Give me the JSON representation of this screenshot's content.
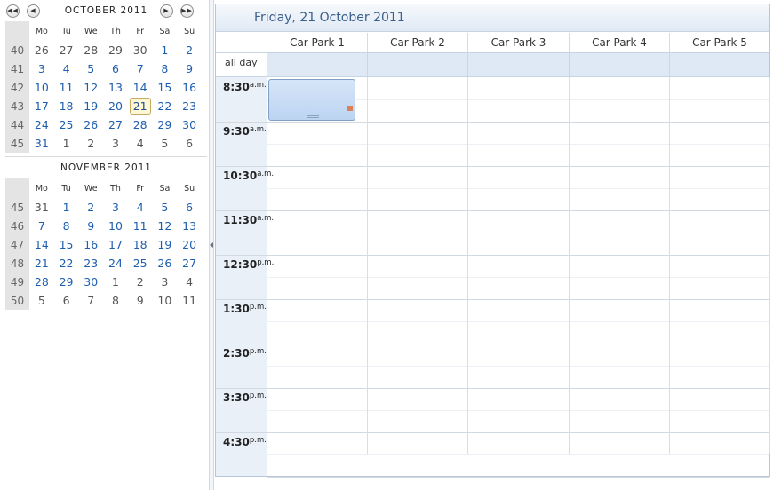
{
  "calendar": {
    "october": {
      "title": "OCTOBER 2011",
      "weekdays": [
        "Mo",
        "Tu",
        "We",
        "Th",
        "Fr",
        "Sa",
        "Su"
      ],
      "weeks": [
        {
          "wk": "40",
          "days": [
            "26",
            "27",
            "28",
            "29",
            "30",
            "1",
            "2"
          ]
        },
        {
          "wk": "41",
          "days": [
            "3",
            "4",
            "5",
            "6",
            "7",
            "8",
            "9"
          ]
        },
        {
          "wk": "42",
          "days": [
            "10",
            "11",
            "12",
            "13",
            "14",
            "15",
            "16"
          ]
        },
        {
          "wk": "43",
          "days": [
            "17",
            "18",
            "19",
            "20",
            "21",
            "22",
            "23"
          ]
        },
        {
          "wk": "44",
          "days": [
            "24",
            "25",
            "26",
            "27",
            "28",
            "29",
            "30"
          ]
        },
        {
          "wk": "45",
          "days": [
            "31",
            "1",
            "2",
            "3",
            "4",
            "5",
            "6"
          ]
        }
      ]
    },
    "november": {
      "title": "NOVEMBER 2011",
      "weekdays": [
        "Mo",
        "Tu",
        "We",
        "Th",
        "Fr",
        "Sa",
        "Su"
      ],
      "weeks": [
        {
          "wk": "45",
          "days": [
            "31",
            "1",
            "2",
            "3",
            "4",
            "5",
            "6"
          ]
        },
        {
          "wk": "46",
          "days": [
            "7",
            "8",
            "9",
            "10",
            "11",
            "12",
            "13"
          ]
        },
        {
          "wk": "47",
          "days": [
            "14",
            "15",
            "16",
            "17",
            "18",
            "19",
            "20"
          ]
        },
        {
          "wk": "48",
          "days": [
            "21",
            "22",
            "23",
            "24",
            "25",
            "26",
            "27"
          ]
        },
        {
          "wk": "49",
          "days": [
            "28",
            "29",
            "30",
            "1",
            "2",
            "3",
            "4"
          ]
        },
        {
          "wk": "50",
          "days": [
            "5",
            "6",
            "7",
            "8",
            "9",
            "10",
            "11"
          ]
        }
      ]
    },
    "nav": {
      "prev_fast": "◀◀",
      "prev": "◀",
      "next": "▶",
      "next_fast": "▶▶"
    }
  },
  "scheduler": {
    "date_header": "Friday, 21 October 2011",
    "all_day_label": "all day",
    "resources": [
      "Car Park 1",
      "Car Park 2",
      "Car Park 3",
      "Car Park 4",
      "Car Park 5"
    ],
    "times": [
      {
        "h": "8:30",
        "ampm": "a.m."
      },
      {
        "h": "9:30",
        "ampm": "a.m."
      },
      {
        "h": "10:30",
        "ampm": "a.m."
      },
      {
        "h": "11:30",
        "ampm": "a.m."
      },
      {
        "h": "12:30",
        "ampm": "p.m."
      },
      {
        "h": "1:30",
        "ampm": "p.m."
      },
      {
        "h": "2:30",
        "ampm": "p.m."
      },
      {
        "h": "3:30",
        "ampm": "p.m."
      },
      {
        "h": "4:30",
        "ampm": "p.m."
      }
    ]
  },
  "colors": {
    "day_link": "#1e5eaf",
    "header_text": "#3b5f8a",
    "appointment_fill": "#c8dcf5",
    "all_day_fill": "#dfe9f5",
    "time_column_fill": "#e9f0f8"
  }
}
